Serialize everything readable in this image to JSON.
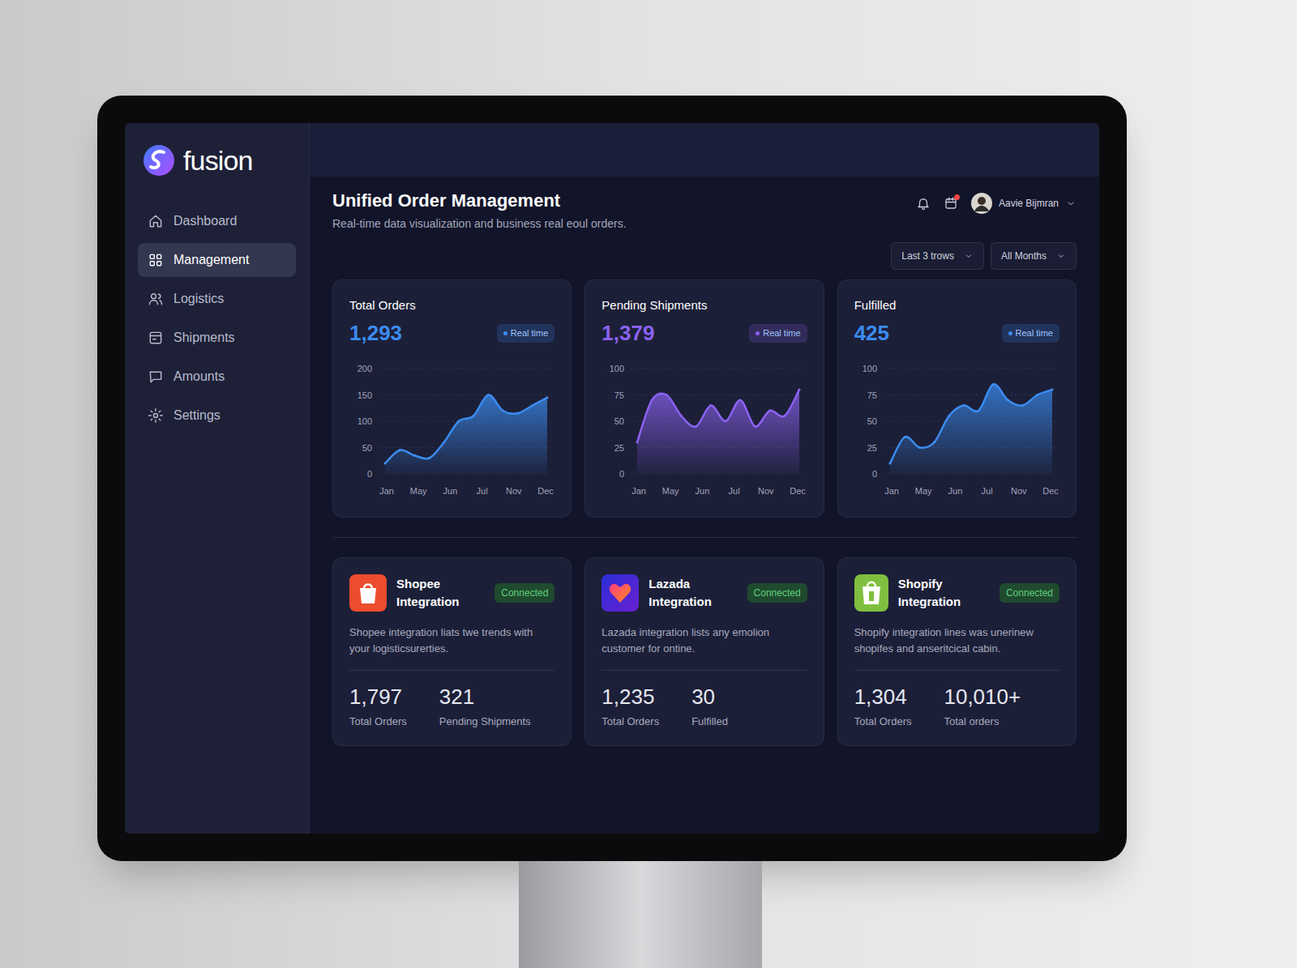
{
  "brand": {
    "name": "fusion"
  },
  "sidebar": {
    "items": [
      {
        "label": "Dashboard",
        "selected": false
      },
      {
        "label": "Management",
        "selected": true
      },
      {
        "label": "Logistics",
        "selected": false
      },
      {
        "label": "Shipments",
        "selected": false
      },
      {
        "label": "Amounts",
        "selected": false
      },
      {
        "label": "Settings",
        "selected": false
      }
    ]
  },
  "header": {
    "title": "Unified Order Management",
    "subtitle": "Real-time data visualization and business real eoul orders.",
    "user": "Aavie Bijmran"
  },
  "filters": [
    "Last 3 trows",
    "All Months"
  ],
  "stats": [
    {
      "title": "Total Orders",
      "value": "1,293",
      "badge": "Real time",
      "color": "#3b8cf0",
      "y_ticks": [
        "200",
        "150",
        "100",
        "50",
        "0"
      ],
      "x_labels": [
        "Jan",
        "May",
        "Jun",
        "Jul",
        "Nov",
        "Dec"
      ],
      "values": [
        20,
        45,
        35,
        30,
        60,
        100,
        110,
        150,
        120,
        115,
        130,
        145
      ]
    },
    {
      "title": "Pending Shipments",
      "value": "1,379",
      "badge": "Real time",
      "color": "#8b62f0",
      "y_ticks": [
        "100",
        "75",
        "50",
        "25",
        "0"
      ],
      "x_labels": [
        "Jan",
        "May",
        "Jun",
        "Jul",
        "Nov",
        "Dec"
      ],
      "values": [
        30,
        70,
        75,
        55,
        45,
        65,
        50,
        70,
        45,
        60,
        55,
        80
      ]
    },
    {
      "title": "Fulfilled",
      "value": "425",
      "badge": "Real time",
      "color": "#3b8cf0",
      "y_ticks": [
        "100",
        "75",
        "50",
        "25",
        "0"
      ],
      "x_labels": [
        "Jan",
        "May",
        "Jun",
        "Jul",
        "Nov",
        "Dec"
      ],
      "values": [
        10,
        35,
        25,
        30,
        55,
        65,
        60,
        85,
        70,
        65,
        75,
        80
      ]
    }
  ],
  "integrations": [
    {
      "kind": "shopee",
      "name": "Shopee Integration",
      "status": "Connected",
      "description": "Shopee integration liats twe trends with your logisticsurerties.",
      "stats": [
        {
          "value": "1,797",
          "label": "Total Orders"
        },
        {
          "value": "321",
          "label": "Pending Shipments"
        }
      ]
    },
    {
      "kind": "lazada",
      "name": "Lazada Integration",
      "status": "Connected",
      "description": "Lazada integration lists any emolion customer for ontine.",
      "stats": [
        {
          "value": "1,235",
          "label": "Total Orders"
        },
        {
          "value": "30",
          "label": "Fulfilled"
        }
      ]
    },
    {
      "kind": "shopify",
      "name": "Shopify Integration",
      "status": "Connected",
      "description": "Shopify integration lines was unerinew shopifes and anseritcical cabin.",
      "stats": [
        {
          "value": "1,304",
          "label": "Total Orders"
        },
        {
          "value": "10,010+",
          "label": "Total orders"
        }
      ]
    }
  ]
}
